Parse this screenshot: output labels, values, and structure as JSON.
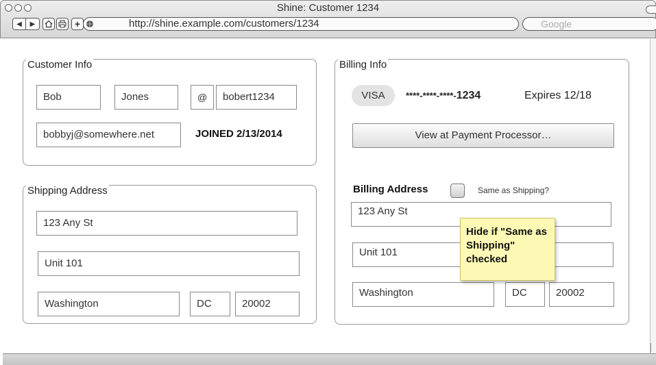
{
  "window": {
    "title": "Shine: Customer 1234",
    "url": "http://shine.example.com/customers/1234",
    "search_placeholder": "Google",
    "nav": {
      "back": "◀",
      "forward": "▶",
      "add_tab": "+"
    }
  },
  "customer_info": {
    "title": "Customer Info",
    "first_name": "Bob",
    "last_name": "Jones",
    "at_symbol": "@",
    "username": "bobert1234",
    "email": "bobbyj@somewhere.net",
    "joined": "JOINED 2/13/2014"
  },
  "shipping_address": {
    "title": "Shipping Address",
    "street": "123 Any St",
    "unit": "Unit 101",
    "city": "Washington",
    "state": "DC",
    "zip": "20002"
  },
  "billing_info": {
    "title": "Billing Info",
    "card_brand": "VISA",
    "card_mask_prefix": "****-****-****-",
    "card_last4": "1234",
    "expires": "Expires 12/18",
    "view_button": "View at Payment Processor…",
    "billing_address_label": "Billing Address",
    "same_as_shipping_label": "Same as Shipping?",
    "same_as_shipping_checked": false,
    "street": "123 Any St",
    "unit": "Unit 101",
    "city": "Washington",
    "state": "DC",
    "zip": "20002"
  },
  "annotation": {
    "note": "Hide if \"Same as Shipping\" checked",
    "color": "#fdf9b4"
  }
}
